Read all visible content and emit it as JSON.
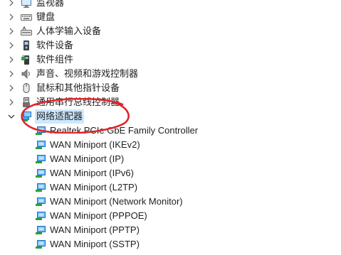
{
  "tree": {
    "collapsed_categories": [
      {
        "label": "监视器",
        "icon": "monitor-icon"
      },
      {
        "label": "键盘",
        "icon": "keyboard-icon"
      },
      {
        "label": "人体学输入设备",
        "icon": "hid-icon"
      },
      {
        "label": "软件设备",
        "icon": "software-device-icon"
      },
      {
        "label": "软件组件",
        "icon": "software-component-icon"
      },
      {
        "label": "声音、视频和游戏控制器",
        "icon": "speaker-icon"
      },
      {
        "label": "鼠标和其他指针设备",
        "icon": "mouse-icon"
      },
      {
        "label": "通用串行总线控制器",
        "icon": "usb-icon"
      }
    ],
    "expanded_category": {
      "label": "网络适配器",
      "icon": "network-adapter-icon",
      "state": "expanded",
      "highlighted": true,
      "children": [
        "Realtek PCIe GbE Family Controller",
        "WAN Miniport (IKEv2)",
        "WAN Miniport (IP)",
        "WAN Miniport (IPv6)",
        "WAN Miniport (L2TP)",
        "WAN Miniport (Network Monitor)",
        "WAN Miniport (PPPOE)",
        "WAN Miniport (PPTP)",
        "WAN Miniport (SSTP)"
      ]
    }
  },
  "colors": {
    "selection": "#cce8ff",
    "annotation_circle": "#e0242a",
    "network_icon_blue": "#1e88e5",
    "text": "#1f1f1f"
  }
}
